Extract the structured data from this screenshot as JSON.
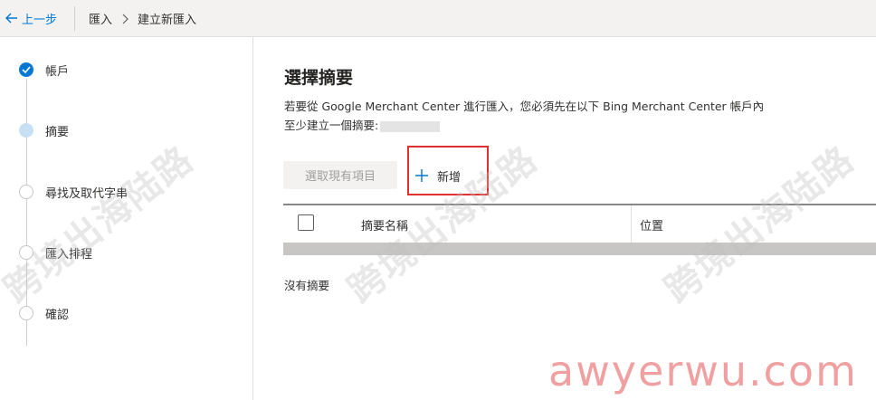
{
  "topbar": {
    "back_label": "上一步",
    "breadcrumb": [
      "匯入",
      "建立新匯入"
    ]
  },
  "steps": [
    {
      "label": "帳戶",
      "state": "done"
    },
    {
      "label": "摘要",
      "state": "current"
    },
    {
      "label": "尋找及取代字串",
      "state": "todo"
    },
    {
      "label": "匯入排程",
      "state": "todo"
    },
    {
      "label": "確認",
      "state": "todo"
    }
  ],
  "main": {
    "title": "選擇摘要",
    "description_line1": "若要從 Google Merchant Center 進行匯入，您必須先在以下 Bing Merchant Center 帳戶內",
    "description_line2": "至少建立一個摘要:",
    "select_existing_label": "選取現有項目",
    "add_label": "新增",
    "columns": [
      "摘要名稱",
      "位置"
    ],
    "empty_text": "沒有摘要"
  },
  "watermark": {
    "text": "跨境出海陆路",
    "site": "awyerwu.com"
  },
  "colors": {
    "accent": "#0078d4",
    "highlight_box": "#e03131"
  }
}
